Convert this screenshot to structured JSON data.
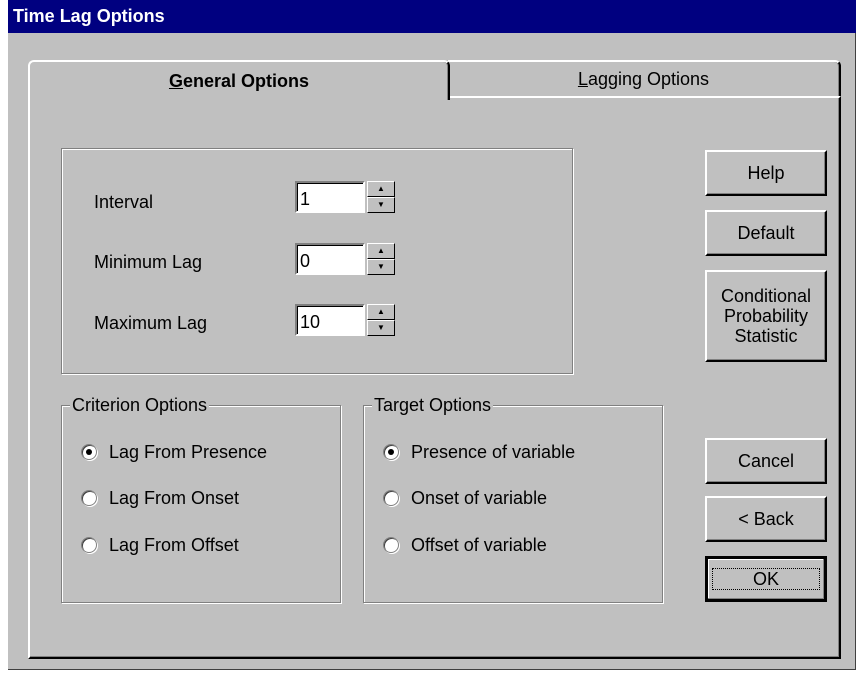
{
  "window": {
    "title": "Time Lag Options"
  },
  "tabs": [
    {
      "label_prefix": "",
      "label_underline": "G",
      "label_rest": "eneral Options",
      "active": true
    },
    {
      "label_prefix": "",
      "label_underline": "L",
      "label_rest": "agging Options",
      "active": false
    }
  ],
  "lag_settings": {
    "interval": {
      "label": "Interval",
      "value": "1"
    },
    "minimum_lag": {
      "label": "Minimum Lag",
      "value": "0"
    },
    "maximum_lag": {
      "label": "Maximum Lag",
      "value": "10"
    }
  },
  "criterion_options": {
    "title": "Criterion Options",
    "options": [
      {
        "label": "Lag From Presence",
        "checked": true
      },
      {
        "label": "Lag From Onset",
        "checked": false
      },
      {
        "label": "Lag From Offset",
        "checked": false
      }
    ]
  },
  "target_options": {
    "title": "Target Options",
    "options": [
      {
        "label": "Presence of variable",
        "checked": true
      },
      {
        "label": "Onset of variable",
        "checked": false
      },
      {
        "label": "Offset of variable",
        "checked": false
      }
    ]
  },
  "buttons": {
    "help": "Help",
    "default": "Default",
    "conditional_line1": "Conditional",
    "conditional_line2": "Probability",
    "conditional_line3": "Statistic",
    "cancel": "Cancel",
    "back": "< Back",
    "ok": "OK"
  },
  "icons": {
    "spin_up": "spin-up-arrow-icon",
    "spin_down": "spin-down-arrow-icon"
  },
  "colors": {
    "titlebar": "#000080",
    "face": "#c0c0c0"
  }
}
